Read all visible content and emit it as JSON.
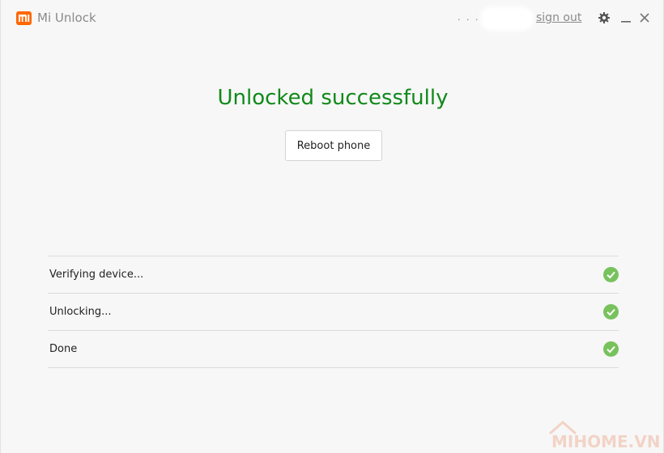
{
  "titlebar": {
    "app_title": "Mi Unlock",
    "masked_user": ". . . .",
    "signout_label": "sign out",
    "brand_color": "#ff6700",
    "icons": [
      "mi-logo-icon",
      "gear-icon",
      "minimize-icon",
      "close-icon"
    ]
  },
  "main": {
    "headline": "Unlocked successfully",
    "headline_color": "#11891a",
    "reboot_label": "Reboot phone"
  },
  "steps": [
    {
      "label": "Verifying device...",
      "status": "done"
    },
    {
      "label": "Unlocking...",
      "status": "done"
    },
    {
      "label": "Done",
      "status": "done"
    }
  ],
  "check_color": "#78c25e",
  "watermark": {
    "text": "MIHOME.VN"
  }
}
